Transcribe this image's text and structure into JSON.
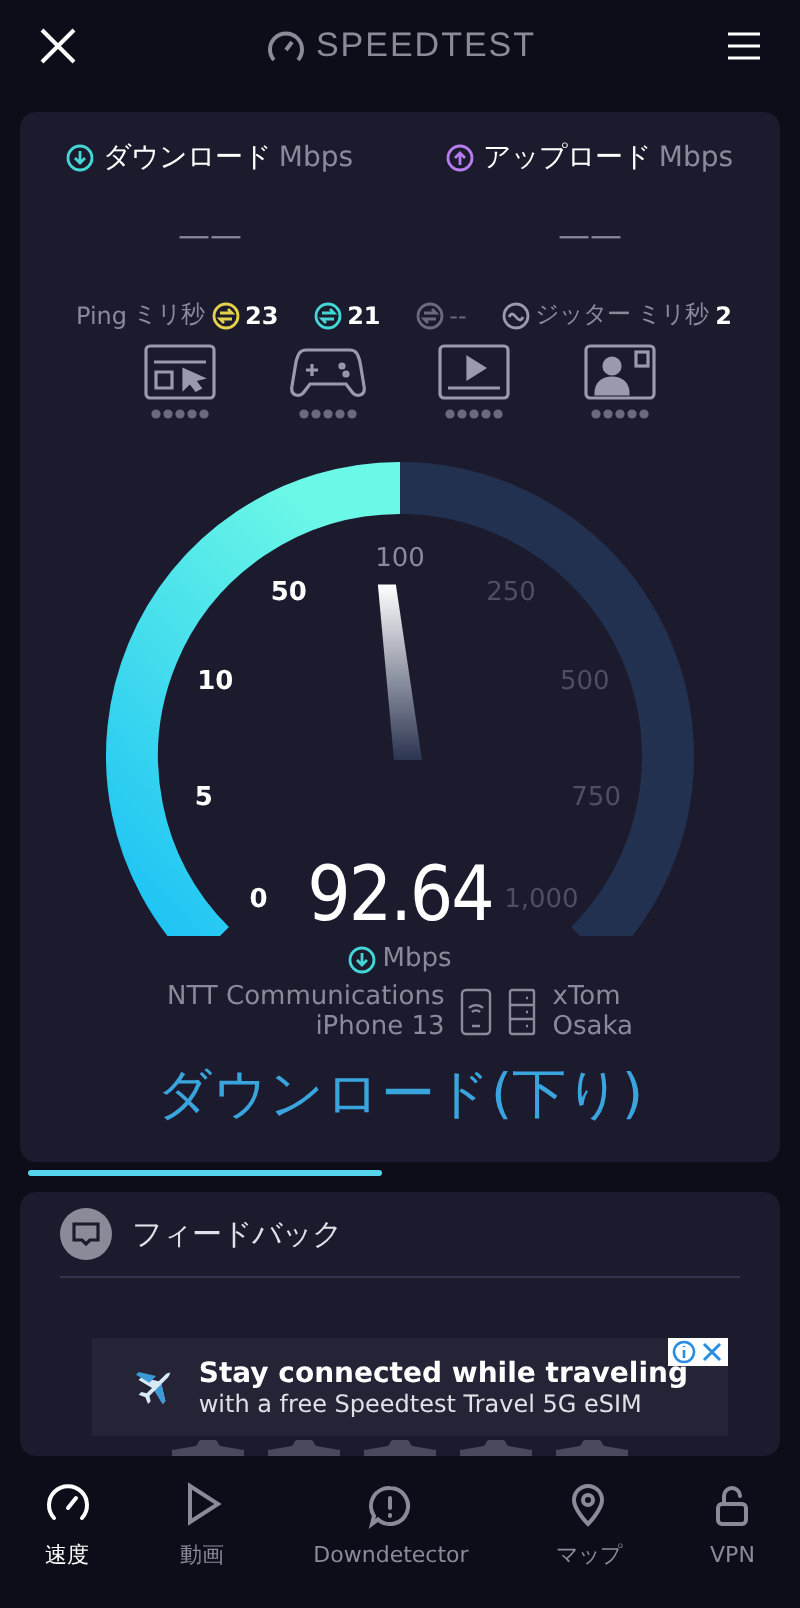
{
  "header": {
    "logo": "SPEEDTEST"
  },
  "results": [
    {
      "kind": "download",
      "label": "ダウンロード",
      "unit": "Mbps",
      "value": "——"
    },
    {
      "kind": "upload",
      "label": "アップロード",
      "unit": "Mbps",
      "value": "——"
    }
  ],
  "latency": {
    "ping_label": "Ping",
    "ping_unit": "ミリ秒",
    "idle": "23",
    "download": "21",
    "upload": "--",
    "jitter_label": "ジッター",
    "jitter_unit": "ミリ秒",
    "jitter": "2"
  },
  "activities": [
    {
      "kind": "browsing"
    },
    {
      "kind": "gaming"
    },
    {
      "kind": "video"
    },
    {
      "kind": "calls"
    }
  ],
  "gauge": {
    "ticks": [
      "0",
      "5",
      "10",
      "50",
      "100",
      "250",
      "500",
      "750",
      "1,000"
    ],
    "reading": "92.64",
    "unit": "Mbps"
  },
  "connection": {
    "provider": "NTT Communications",
    "device": "iPhone 13",
    "server": "xTom",
    "location": "Osaka"
  },
  "phase": "ダウンロード(下り)",
  "feedback": {
    "title": "フィードバック"
  },
  "ad": {
    "title": "Stay connected while traveling",
    "subtitle": "with a free Speedtest Travel 5G eSIM"
  },
  "nav": [
    {
      "label": "速度",
      "kind": "speed",
      "selected": true
    },
    {
      "label": "動画",
      "kind": "video",
      "selected": false
    },
    {
      "label": "Downdetector",
      "kind": "alert",
      "selected": false
    },
    {
      "label": "マップ",
      "kind": "map",
      "selected": false
    },
    {
      "label": "VPN",
      "kind": "vpn",
      "selected": false
    }
  ]
}
